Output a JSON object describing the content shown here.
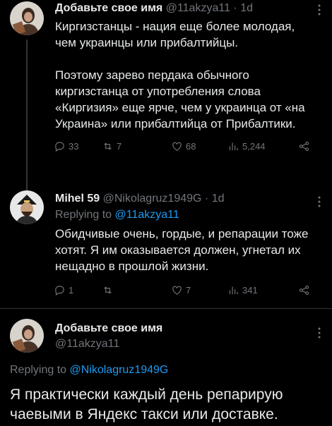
{
  "tweets": [
    {
      "name": "Добавьте свое имя",
      "handle": "@11akzya11",
      "time": "1d",
      "text": "Киргизстанцы - нация еще более молодая, чем украинцы или прибалтийцы.\n\nПоэтому зарево пердака обычного киргизстанца от употребления слова «Киргизия» еще ярче, чем у украинца от «на Украина» или прибалтийца от Прибалтики.",
      "replies": "33",
      "retweets": "7",
      "likes": "68",
      "views": "5,244"
    },
    {
      "name": "Mihel 59",
      "handle": "@Nikolagruz1949G",
      "time": "1d",
      "replying_label": "Replying to",
      "replying_handle": "@11akzya11",
      "text": "Обидчивые очень, гордые, и репарации тоже хотят. Я им оказывается должен, угнетал их нещадно в прошлой жизни.",
      "replies": "1",
      "retweets": "",
      "likes": "7",
      "views": "341"
    }
  ],
  "main_tweet": {
    "name": "Добавьте свое имя",
    "handle": "@11akzya11",
    "replying_label": "Replying to",
    "replying_handle": "@Nikolagruz1949G",
    "text": "Я практически каждый день репарирую чаевыми в Яндекс такси или доставке."
  },
  "separator": "·",
  "colors": {
    "background": "#000000",
    "text": "#e7e9ea",
    "muted": "#71767b",
    "accent": "#1d9bf0"
  }
}
